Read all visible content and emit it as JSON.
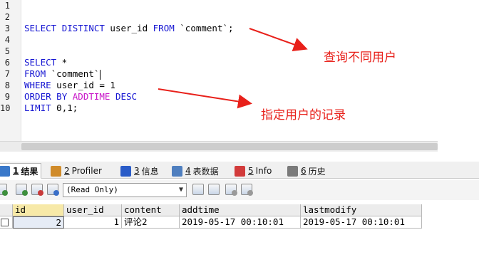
{
  "editor": {
    "line_numbers": [
      "1",
      "2",
      "3",
      "4",
      "5",
      "6",
      "7",
      "8",
      "9",
      "10"
    ],
    "lines": [
      {
        "tokens": []
      },
      {
        "tokens": []
      },
      {
        "tokens": [
          {
            "t": "SELECT",
            "c": "kw"
          },
          {
            "t": " "
          },
          {
            "t": "DISTINCT",
            "c": "kw"
          },
          {
            "t": " user_id "
          },
          {
            "t": "FROM",
            "c": "kw"
          },
          {
            "t": " `comment`;"
          }
        ]
      },
      {
        "tokens": []
      },
      {
        "tokens": []
      },
      {
        "tokens": [
          {
            "t": "SELECT",
            "c": "kw"
          },
          {
            "t": " *"
          }
        ]
      },
      {
        "tokens": [
          {
            "t": "FROM",
            "c": "kw"
          },
          {
            "t": " `comment`"
          },
          {
            "t": "",
            "c": "caret"
          }
        ]
      },
      {
        "tokens": [
          {
            "t": "WHERE",
            "c": "kw"
          },
          {
            "t": " user_id = 1"
          }
        ]
      },
      {
        "tokens": [
          {
            "t": "ORDER",
            "c": "kw"
          },
          {
            "t": " "
          },
          {
            "t": "BY",
            "c": "kw"
          },
          {
            "t": " "
          },
          {
            "t": "ADDTIME",
            "c": "fn"
          },
          {
            "t": " "
          },
          {
            "t": "DESC",
            "c": "kw"
          }
        ]
      },
      {
        "tokens": [
          {
            "t": "LIMIT",
            "c": "kw"
          },
          {
            "t": " 0,1;"
          }
        ]
      }
    ]
  },
  "annotations": {
    "distinct_users": "查询不同用户",
    "user_records": "指定用户的记录"
  },
  "tabs": [
    {
      "num": "1",
      "label": "结果",
      "icon": "grid-icon",
      "color": "#3a78c9",
      "active": true
    },
    {
      "num": "2",
      "label": "Profiler",
      "icon": "profiler-icon",
      "color": "#d08b2a",
      "active": false
    },
    {
      "num": "3",
      "label": "信息",
      "icon": "info-icon",
      "color": "#2a5cc8",
      "active": false
    },
    {
      "num": "4",
      "label": "表数据",
      "icon": "table-data-icon",
      "color": "#4f7fbf",
      "active": false
    },
    {
      "num": "5",
      "label": "Info",
      "icon": "info-shapes-icon",
      "color": "#d23b3b",
      "active": false
    },
    {
      "num": "6",
      "label": "历史",
      "icon": "calendar-icon",
      "color": "#7a7a7a",
      "active": false
    }
  ],
  "toolbar": {
    "mode_select": "(Read Only)",
    "left_buttons": [
      "export-icon",
      "add-row-icon",
      "delete-row-icon",
      "refresh-icon"
    ],
    "right_buttons": [
      "copy-icon",
      "save-icon",
      "cancel-icon",
      "reset-icon"
    ]
  },
  "grid": {
    "columns": [
      "id",
      "user_id",
      "content",
      "addtime",
      "lastmodify"
    ],
    "rows": [
      [
        "2",
        "1",
        "评论2",
        "2019-05-17 00:10:01",
        "2019-05-17 00:10:01"
      ]
    ]
  }
}
